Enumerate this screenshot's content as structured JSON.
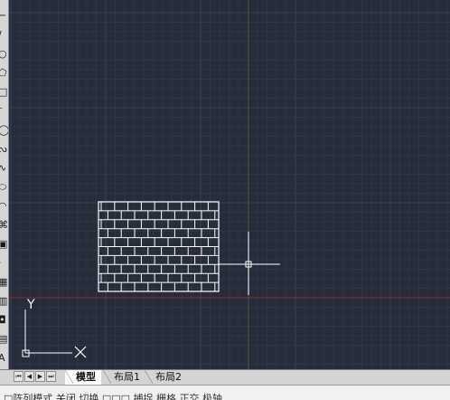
{
  "window": {
    "title": ""
  },
  "colors": {
    "canvas": "#262c3a",
    "grid_minor": "#2f3545",
    "grid_major": "#3a4152",
    "x_axis": "#8a2a36",
    "y_axis": "#3d5a3a",
    "geometry": "#ffffff",
    "crosshair": "#ffffff"
  },
  "left_toolbar": {
    "tools": [
      {
        "name": "polyline-tool",
        "glyph": "⌐"
      },
      {
        "name": "line-tool",
        "glyph": "/"
      },
      {
        "name": "circle-tool",
        "glyph": "○"
      },
      {
        "name": "polygon-tool",
        "glyph": "⬠"
      },
      {
        "name": "rectangle-tool",
        "glyph": "□"
      },
      {
        "name": "arc-tool",
        "glyph": "◜"
      },
      {
        "name": "circle-2-tool",
        "glyph": "◯"
      },
      {
        "name": "revcloud-tool",
        "glyph": "ᔓ"
      },
      {
        "name": "spline-tool",
        "glyph": "∿"
      },
      {
        "name": "ellipse-tool",
        "glyph": "⬭"
      },
      {
        "name": "ellipse-arc-tool",
        "glyph": "◠"
      },
      {
        "name": "insert-block-tool",
        "glyph": "⌘"
      },
      {
        "name": "make-block-tool",
        "glyph": "▣"
      },
      {
        "name": "point-tool",
        "glyph": "·"
      },
      {
        "name": "hatch-tool",
        "glyph": "▦"
      },
      {
        "name": "gradient-tool",
        "glyph": "▥"
      },
      {
        "name": "region-tool",
        "glyph": "◘"
      },
      {
        "name": "table-tool",
        "glyph": "▤"
      },
      {
        "name": "mtext-tool",
        "glyph": "A"
      }
    ]
  },
  "canvas": {
    "brick_hatch_rows": 10,
    "ucs_icon": {
      "y_label": "Y",
      "x_label": "X"
    }
  },
  "tab_bar": {
    "nav_buttons": [
      {
        "name": "first-tab-button",
        "glyph": "⏮"
      },
      {
        "name": "prev-tab-button",
        "glyph": "◀"
      },
      {
        "name": "next-tab-button",
        "glyph": "▶"
      },
      {
        "name": "last-tab-button",
        "glyph": "⏭"
      }
    ],
    "tabs": [
      {
        "label": "模型",
        "active": true
      },
      {
        "label": "布局1",
        "active": false
      },
      {
        "label": "布局2",
        "active": false
      }
    ]
  },
  "command_line": {
    "text": "□阵列模式 关闭 切换  □□□ 捕捉 栅格 正交 极轴"
  }
}
